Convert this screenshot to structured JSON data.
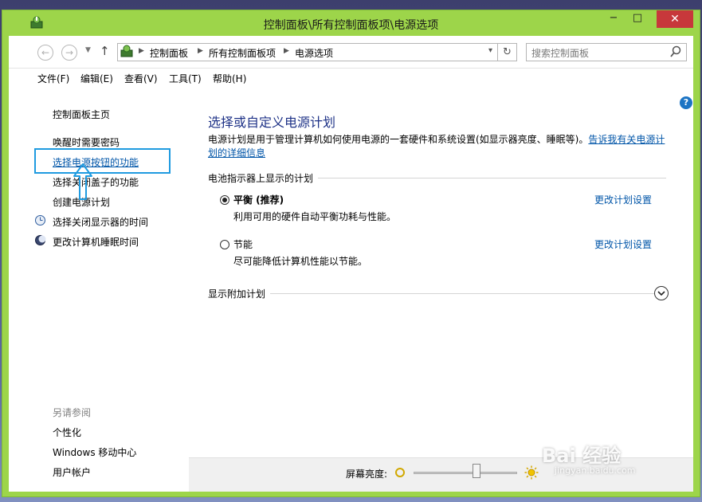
{
  "window": {
    "title": "控制面板\\所有控制面板项\\电源选项",
    "accent": "#9dd54a",
    "close_color": "#c7383b",
    "min_label": "−",
    "max_label": "□",
    "close_label": "✕"
  },
  "navigation": {
    "breadcrumbs": [
      "控制面板",
      "所有控制面板项",
      "电源选项"
    ],
    "search_placeholder": "搜索控制面板"
  },
  "menubar": {
    "items": [
      "文件(F)",
      "编辑(E)",
      "查看(V)",
      "工具(T)",
      "帮助(H)"
    ]
  },
  "left_pane": {
    "home": "控制面板主页",
    "links": [
      "唤醒时需要密码",
      "选择电源按钮的功能",
      "选择关闭盖子的功能",
      "创建电源计划",
      "选择关闭显示器的时间",
      "更改计算机睡眠时间"
    ],
    "see_also_title": "另请参阅",
    "see_also": [
      "个性化",
      "Windows 移动中心",
      "用户帐户"
    ]
  },
  "main": {
    "title": "选择或自定义电源计划",
    "description": "电源计划是用于管理计算机如何使用电源的一套硬件和系统设置(如显示器亮度、睡眠等)。",
    "description_link": "告诉我有关电源计划的详细信息",
    "battery_section": "电池指示器上显示的计划",
    "plans": [
      {
        "name": "平衡 (推荐)",
        "desc": "利用可用的硬件自动平衡功耗与性能。",
        "link": "更改计划设置",
        "selected": true
      },
      {
        "name": "节能",
        "desc": "尽可能降低计算机性能以节能。",
        "link": "更改计划设置",
        "selected": false
      }
    ],
    "more_plans": "显示附加计划"
  },
  "bottom": {
    "brightness_label": "屏幕亮度:",
    "brightness_level": 0.62
  },
  "watermark": {
    "text": "Bai 经验",
    "sub": "jingyan.baidu.com"
  }
}
